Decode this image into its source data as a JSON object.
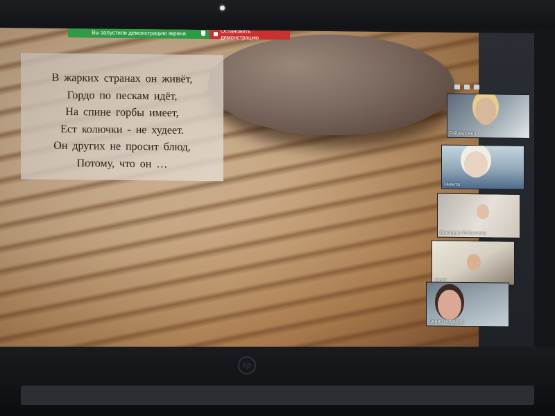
{
  "share_bar": {
    "notice": "Вы запустили демонстрацию экрана",
    "stop_label": "Остановить демонстрацию",
    "notice_color": "#2e9a45",
    "stop_color": "#c8312e"
  },
  "slide": {
    "poem": [
      "В  жарких  странах он живёт,",
      "Гордо  по пескам  идёт,",
      "На  спине  горбы  имеет,",
      "Ест  колючки   - не худеет.",
      "Он  других не  просит блюд,",
      "Потому,  что он  …"
    ]
  },
  "participants": [
    {
      "name": "Гайдаровец"
    },
    {
      "name": "Никита"
    },
    {
      "name": "Виктория Избастина"
    },
    {
      "name": "конст"
    },
    {
      "name": "Денис Романов"
    }
  ],
  "device": {
    "logo": "hp"
  }
}
